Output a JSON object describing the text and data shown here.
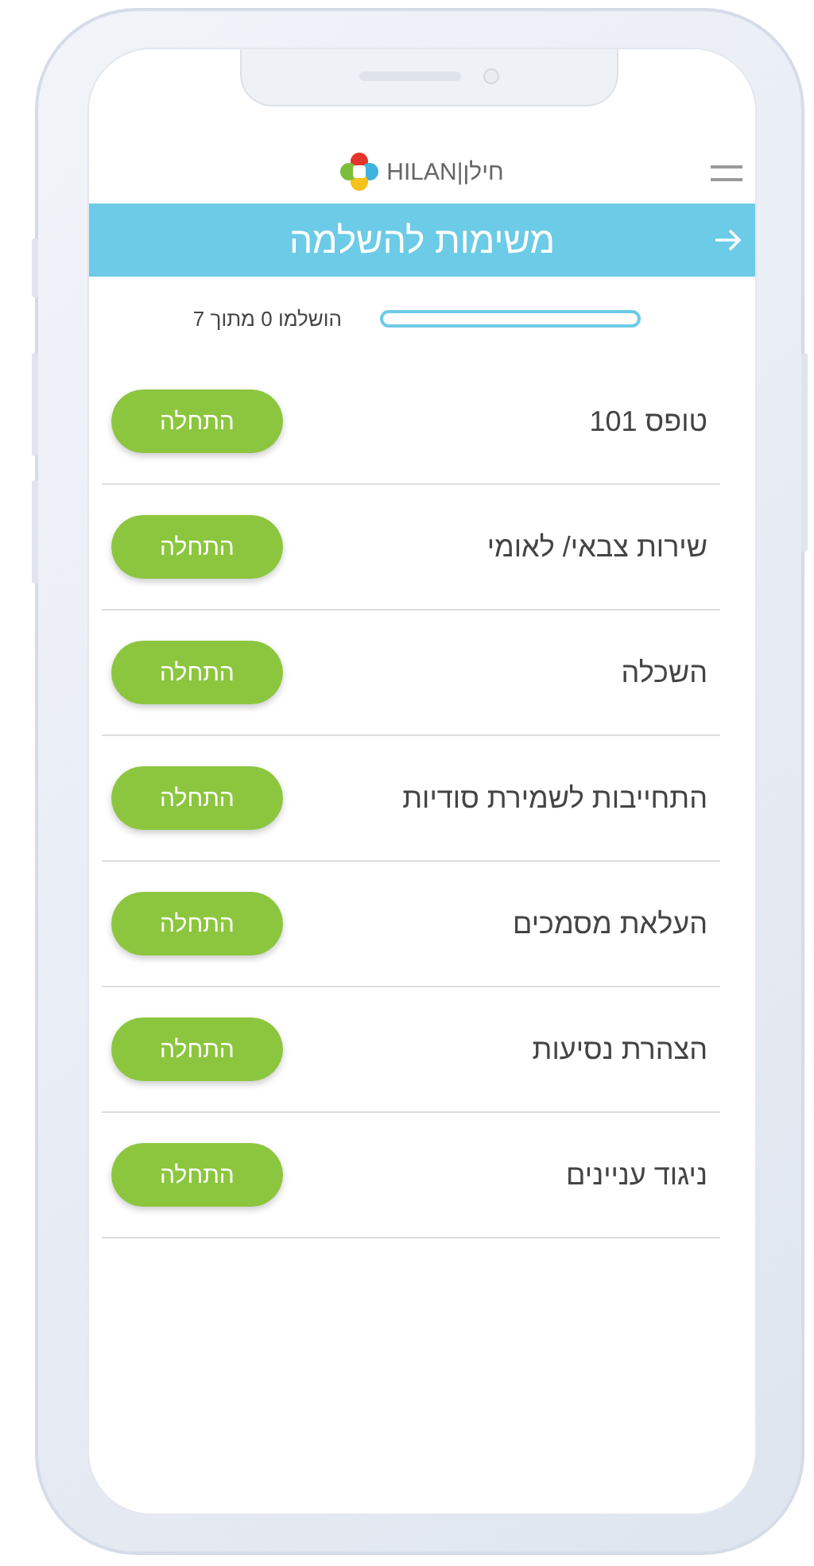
{
  "header": {
    "logo_text": "HILAN|חילן"
  },
  "title_bar": {
    "title": "משימות להשלמה"
  },
  "progress": {
    "level": 0,
    "label": "הושלמו 0 מתוך 7"
  },
  "tasks": [
    {
      "title": "טופס 101",
      "button": "התחלה"
    },
    {
      "title": "שירות צבאי/ לאומי",
      "button": "התחלה"
    },
    {
      "title": "השכלה",
      "button": "התחלה"
    },
    {
      "title": "התחייבות לשמירת סודיות",
      "button": "התחלה"
    },
    {
      "title": "העלאת מסמכים",
      "button": "התחלה"
    },
    {
      "title": "הצהרת נסיעות",
      "button": "התחלה"
    },
    {
      "title": "ניגוד עניינים",
      "button": "התחלה"
    }
  ]
}
